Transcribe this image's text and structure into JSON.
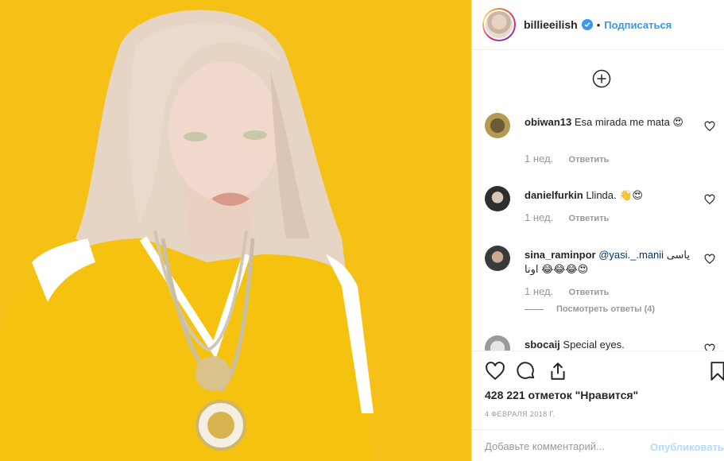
{
  "post": {
    "image_alt": "Photo of a person with light blond hair wearing a yellow jersey against a yellow background",
    "colors": {
      "background_yellow": "#f7c51c",
      "jersey_yellow": "#f5c20f",
      "accent_blue": "#3897f0"
    }
  },
  "header": {
    "username": "billieeilish",
    "separator": "•",
    "follow_label": "Подписаться"
  },
  "comments": [
    {
      "username": "obiwan13",
      "text": "Esa mirada me mata 😍",
      "age": "1 нед.",
      "reply_label": "Ответить"
    },
    {
      "username": "danielfurkin",
      "text": "Llinda. 👋😍",
      "age": "1 нед.",
      "reply_label": "Ответить"
    },
    {
      "username": "sina_raminpor",
      "mention": "@yasi._.manii",
      "text": "یاسی اونا 😂😂😂😍",
      "age": "1 нед.",
      "reply_label": "Ответить"
    },
    {
      "username": "sbocaij",
      "text": "Special eyes."
    }
  ],
  "view_replies_label": "Посмотреть ответы (4)",
  "likes_text": "428 221 отметок \"Нравится\"",
  "date_text": "4 ФЕВРАЛЯ 2018 Г.",
  "add_comment": {
    "placeholder": "Добавьте комментарий...",
    "value": "",
    "publish_label": "Опубликовать"
  },
  "icons": [
    "plus-circle-icon",
    "heart-icon",
    "comment-icon",
    "share-icon",
    "bookmark-icon",
    "verified-badge-icon"
  ]
}
